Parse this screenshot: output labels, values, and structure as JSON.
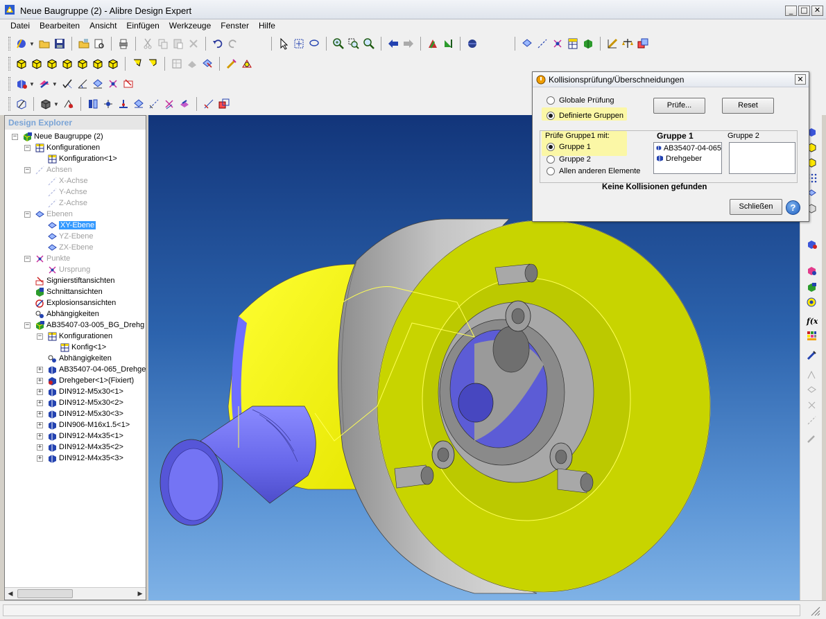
{
  "window": {
    "title": "Neue Baugruppe (2) - Alibre Design Expert",
    "min": "_",
    "max": "□",
    "close": "✕"
  },
  "menu": [
    "Datei",
    "Bearbeiten",
    "Ansicht",
    "Einfügen",
    "Werkzeuge",
    "Fenster",
    "Hilfe"
  ],
  "explorer": {
    "title": "Design Explorer",
    "nodes": [
      {
        "label": "Neue Baugruppe (2)",
        "level": 0,
        "exp": "−",
        "icon": "assembly-icon",
        "dim": false
      },
      {
        "label": "Konfigurationen",
        "level": 1,
        "exp": "−",
        "icon": "config-table-icon",
        "dim": false
      },
      {
        "label": "Konfiguration<1>",
        "level": 2,
        "exp": "",
        "icon": "config-table-icon",
        "dim": false
      },
      {
        "label": "Achsen",
        "level": 1,
        "exp": "−",
        "icon": "axis-icon",
        "dim": true
      },
      {
        "label": "X-Achse",
        "level": 2,
        "exp": "",
        "icon": "axis-icon",
        "dim": true
      },
      {
        "label": "Y-Achse",
        "level": 2,
        "exp": "",
        "icon": "axis-icon",
        "dim": true
      },
      {
        "label": "Z-Achse",
        "level": 2,
        "exp": "",
        "icon": "axis-icon",
        "dim": true
      },
      {
        "label": "Ebenen",
        "level": 1,
        "exp": "−",
        "icon": "plane-icon",
        "dim": true
      },
      {
        "label": "XY-Ebene",
        "level": 2,
        "exp": "",
        "icon": "plane-icon",
        "dim": false,
        "selected": true
      },
      {
        "label": "YZ-Ebene",
        "level": 2,
        "exp": "",
        "icon": "plane-icon",
        "dim": true
      },
      {
        "label": "ZX-Ebene",
        "level": 2,
        "exp": "",
        "icon": "plane-icon",
        "dim": true
      },
      {
        "label": "Punkte",
        "level": 1,
        "exp": "−",
        "icon": "point-icon",
        "dim": true
      },
      {
        "label": "Ursprung",
        "level": 2,
        "exp": "",
        "icon": "point-icon",
        "dim": true
      },
      {
        "label": "Signierstiftansichten",
        "level": 1,
        "exp": "",
        "icon": "pen-view-icon",
        "dim": false
      },
      {
        "label": "Schnittansichten",
        "level": 1,
        "exp": "",
        "icon": "section-view-icon",
        "dim": false
      },
      {
        "label": "Explosionsansichten",
        "level": 1,
        "exp": "",
        "icon": "explode-view-icon",
        "dim": false
      },
      {
        "label": "Abhängigkeiten",
        "level": 1,
        "exp": "",
        "icon": "constraint-icon",
        "dim": false
      },
      {
        "label": "AB35407-03-005_BG_Drehg",
        "level": 1,
        "exp": "−",
        "icon": "assembly-icon",
        "dim": false
      },
      {
        "label": "Konfigurationen",
        "level": 2,
        "exp": "−",
        "icon": "config-table-icon",
        "dim": false
      },
      {
        "label": "Konfig<1>",
        "level": 3,
        "exp": "",
        "icon": "config-table-icon",
        "dim": false
      },
      {
        "label": "Abhängigkeiten",
        "level": 2,
        "exp": "",
        "icon": "constraint-icon",
        "dim": false
      },
      {
        "label": "AB35407-04-065_Drehge",
        "level": 2,
        "exp": "+",
        "icon": "part-icon",
        "dim": false
      },
      {
        "label": "Drehgeber<1>(Fixiert)",
        "level": 2,
        "exp": "+",
        "icon": "part-fixed-icon",
        "dim": false
      },
      {
        "label": "DIN912-M5x30<1>",
        "level": 2,
        "exp": "+",
        "icon": "part-icon",
        "dim": false
      },
      {
        "label": "DIN912-M5x30<2>",
        "level": 2,
        "exp": "+",
        "icon": "part-icon",
        "dim": false
      },
      {
        "label": "DIN912-M5x30<3>",
        "level": 2,
        "exp": "+",
        "icon": "part-icon",
        "dim": false
      },
      {
        "label": "DIN906-M16x1.5<1>",
        "level": 2,
        "exp": "+",
        "icon": "part-icon",
        "dim": false
      },
      {
        "label": "DIN912-M4x35<1>",
        "level": 2,
        "exp": "+",
        "icon": "part-icon",
        "dim": false
      },
      {
        "label": "DIN912-M4x35<2>",
        "level": 2,
        "exp": "+",
        "icon": "part-icon",
        "dim": false
      },
      {
        "label": "DIN912-M4x35<3>",
        "level": 2,
        "exp": "+",
        "icon": "part-icon",
        "dim": false
      }
    ]
  },
  "dialog": {
    "title": "Kollisionsprüfung/Überschneidungen",
    "close": "✕",
    "mode_global": "Globale Prüfung",
    "mode_defined": "Definierte Gruppen",
    "check_button": "Prüfe...",
    "reset_button": "Reset",
    "check_group_label": "Prüfe Gruppe1 mit:",
    "opt_group1": "Gruppe 1",
    "opt_group2": "Gruppe 2",
    "opt_all": "Allen anderen Elemente",
    "group1_header": "Gruppe 1",
    "group2_header": "Gruppe 2",
    "group1_items": [
      "AB35407-04-065",
      "Drehgeber"
    ],
    "result": "Keine Kollisionen gefunden",
    "close_button": "Schließen",
    "help": "?"
  },
  "colors": {
    "accent_yellow": "#c8d400",
    "part_blue": "#6f6ff0",
    "selection": "#3399ff",
    "viewport_top": "#12357a",
    "viewport_bottom": "#7fb2e6"
  }
}
